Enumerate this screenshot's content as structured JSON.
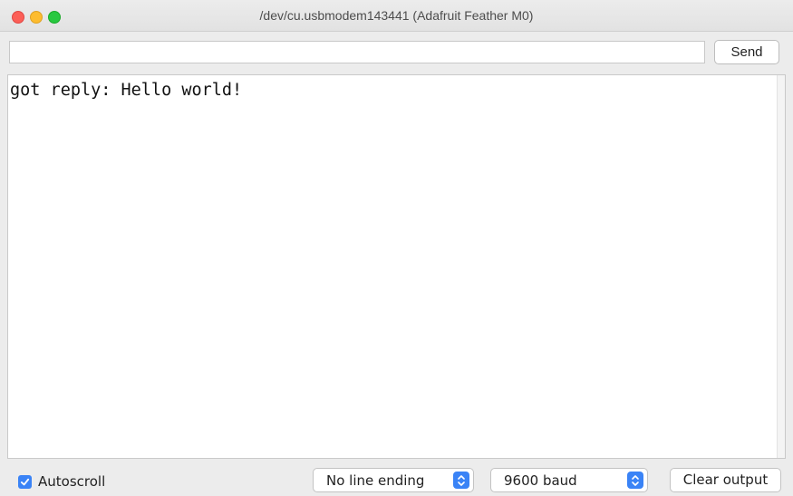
{
  "window": {
    "title": "/dev/cu.usbmodem143441 (Adafruit Feather M0)"
  },
  "send_row": {
    "input_value": "",
    "send_label": "Send"
  },
  "output": {
    "lines": [
      "got reply: Hello world!"
    ]
  },
  "footer": {
    "autoscroll_label": "Autoscroll",
    "autoscroll_checked": true,
    "line_ending_selected": "No line ending",
    "baud_selected": "9600 baud",
    "clear_label": "Clear output"
  },
  "colors": {
    "accent": "#3a83f6",
    "close": "#fc5f57",
    "minimize": "#fdbc2e",
    "maximize": "#28c840"
  },
  "icons": {
    "checkbox": "checkmark-icon",
    "select_arrows": "chevron-up-down-icon"
  }
}
